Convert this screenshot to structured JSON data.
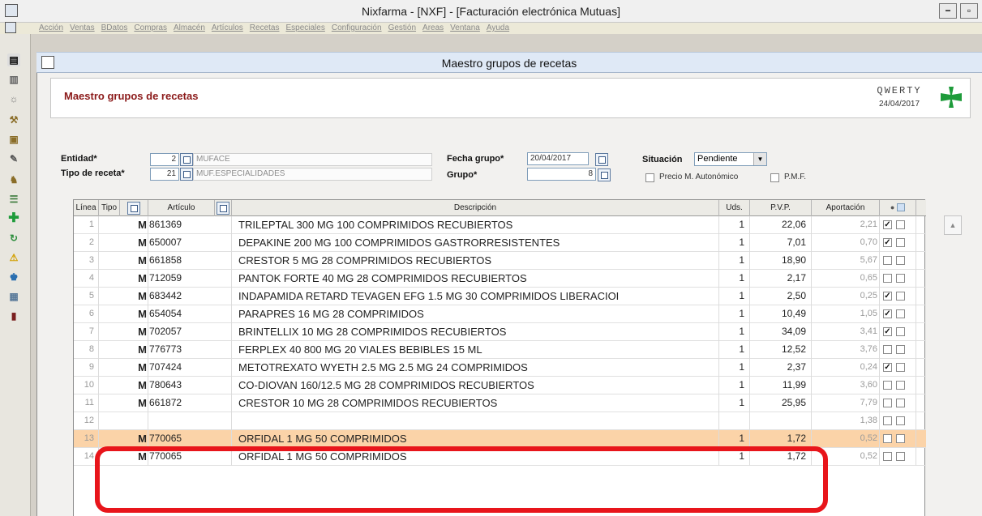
{
  "window": {
    "title": "Nixfarma - [NXF] - [Facturación electrónica Mutuas]",
    "minimize": "−",
    "restore": "▫"
  },
  "menu": [
    "Acción",
    "Ventas",
    "BDatos",
    "Compras",
    "Almacén",
    "Artículos",
    "Recetas",
    "Especiales",
    "Configuración",
    "Gestión",
    "Areas",
    "Ventana",
    "Ayuda"
  ],
  "inner_title": "Maestro grupos de recetas",
  "header": {
    "title": "Maestro grupos de recetas",
    "brand": "QWERTY",
    "date": "24/04/2017"
  },
  "form": {
    "entidad_label": "Entidad*",
    "entidad_code": "2",
    "entidad_name": "MUFACE",
    "tipo_label": "Tipo de receta*",
    "tipo_code": "21",
    "tipo_name": "MUF.ESPECIALIDADES",
    "fecha_label": "Fecha grupo*",
    "fecha_value": "20/04/2017",
    "grupo_label": "Grupo*",
    "grupo_value": "8",
    "situacion_label": "Situación",
    "situacion_value": "Pendiente",
    "precio_label": "Precio M. Autonómico",
    "pmf_label": "P.M.F."
  },
  "columns": {
    "linea": "Línea",
    "tipo": "Tipo",
    "articulo": "Artículo",
    "descripcion": "Descripción",
    "uds": "Uds.",
    "pvp": "P.V.P.",
    "aportacion": "Aportación"
  },
  "rows": [
    {
      "line": "1",
      "tipo": "M",
      "art": "861369",
      "desc": "TRILEPTAL 300 MG 100 COMPRIMIDOS RECUBIERTOS",
      "uds": "1",
      "pvp": "22,06",
      "apo": "2,21",
      "c1": true,
      "c2": false
    },
    {
      "line": "2",
      "tipo": "M",
      "art": "650007",
      "desc": "DEPAKINE 200 MG 100 COMPRIMIDOS GASTRORRESISTENTES",
      "uds": "1",
      "pvp": "7,01",
      "apo": "0,70",
      "c1": true,
      "c2": false
    },
    {
      "line": "3",
      "tipo": "M",
      "art": "661858",
      "desc": "CRESTOR 5 MG 28 COMPRIMIDOS RECUBIERTOS",
      "uds": "1",
      "pvp": "18,90",
      "apo": "5,67",
      "c1": false,
      "c2": false
    },
    {
      "line": "4",
      "tipo": "M",
      "art": "712059",
      "desc": "PANTOK FORTE 40 MG 28 COMPRIMIDOS RECUBIERTOS",
      "uds": "1",
      "pvp": "2,17",
      "apo": "0,65",
      "c1": false,
      "c2": false
    },
    {
      "line": "5",
      "tipo": "M",
      "art": "683442",
      "desc": "INDAPAMIDA RETARD TEVAGEN EFG 1.5 MG 30 COMPRIMIDOS LIBERACIOI",
      "uds": "1",
      "pvp": "2,50",
      "apo": "0,25",
      "c1": true,
      "c2": false
    },
    {
      "line": "6",
      "tipo": "M",
      "art": "654054",
      "desc": "PARAPRES 16 MG 28 COMPRIMIDOS",
      "uds": "1",
      "pvp": "10,49",
      "apo": "1,05",
      "c1": true,
      "c2": false
    },
    {
      "line": "7",
      "tipo": "M",
      "art": "702057",
      "desc": "BRINTELLIX 10 MG 28 COMPRIMIDOS RECUBIERTOS",
      "uds": "1",
      "pvp": "34,09",
      "apo": "3,41",
      "c1": true,
      "c2": false
    },
    {
      "line": "8",
      "tipo": "M",
      "art": "776773",
      "desc": "FERPLEX 40 800 MG 20 VIALES BEBIBLES 15 ML",
      "uds": "1",
      "pvp": "12,52",
      "apo": "3,76",
      "c1": false,
      "c2": false
    },
    {
      "line": "9",
      "tipo": "M",
      "art": "707424",
      "desc": "METOTREXATO WYETH 2.5 MG 2.5 MG 24 COMPRIMIDOS",
      "uds": "1",
      "pvp": "2,37",
      "apo": "0,24",
      "c1": true,
      "c2": false
    },
    {
      "line": "10",
      "tipo": "M",
      "art": "780643",
      "desc": "CO-DIOVAN 160/12.5 MG 28 COMPRIMIDOS RECUBIERTOS",
      "uds": "1",
      "pvp": "11,99",
      "apo": "3,60",
      "c1": false,
      "c2": false
    },
    {
      "line": "11",
      "tipo": "M",
      "art": "661872",
      "desc": "CRESTOR 10 MG 28 COMPRIMIDOS RECUBIERTOS",
      "uds": "1",
      "pvp": "25,95",
      "apo": "7,79",
      "c1": false,
      "c2": false
    },
    {
      "line": "12",
      "tipo": "",
      "art": "",
      "desc": "",
      "uds": "",
      "pvp": "",
      "apo": "1,38",
      "c1": false,
      "c2": false
    },
    {
      "line": "13",
      "tipo": "M",
      "art": "770065",
      "desc": "ORFIDAL 1 MG 50 COMPRIMIDOS",
      "uds": "1",
      "pvp": "1,72",
      "apo": "0,52",
      "c1": false,
      "c2": false,
      "selected": true
    },
    {
      "line": "14",
      "tipo": "M",
      "art": "770065",
      "desc": "ORFIDAL 1 MG 50 COMPRIMIDOS",
      "uds": "1",
      "pvp": "1,72",
      "apo": "0,52",
      "c1": false,
      "c2": false
    }
  ],
  "colors": {
    "header_title": "#8b1a1a",
    "selected_row": "#fbd3a8",
    "highlight_box": "#e8151b",
    "cross": "#1e9b3a"
  }
}
